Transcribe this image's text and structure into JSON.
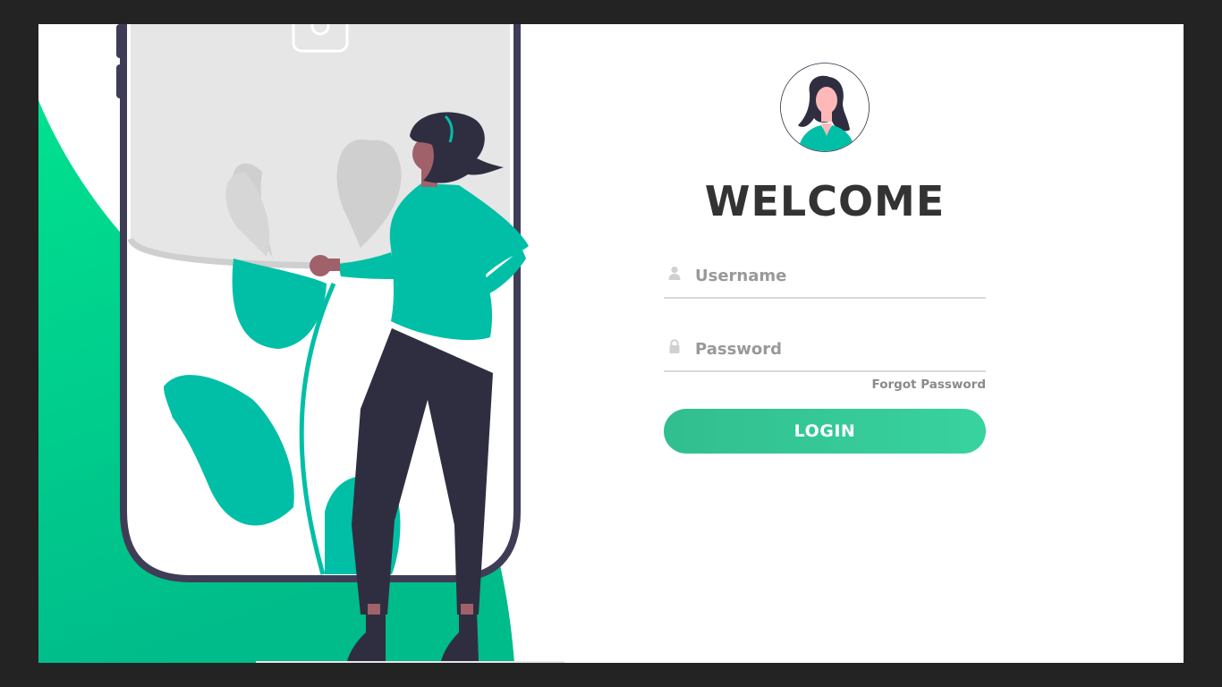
{
  "login": {
    "welcome_title": "WELCOME",
    "username_placeholder": "Username",
    "password_placeholder": "Password",
    "forgot_password": "Forgot Password",
    "login_button": "LOGIN"
  },
  "icons": {
    "username": "user-icon",
    "password": "lock-icon"
  },
  "colors": {
    "background": "#232323",
    "accent_green": "#38d39f",
    "teal": "#00bfa6",
    "dark_text": "#333333",
    "muted_text": "#999999",
    "figure_dark": "#2f2e41"
  }
}
